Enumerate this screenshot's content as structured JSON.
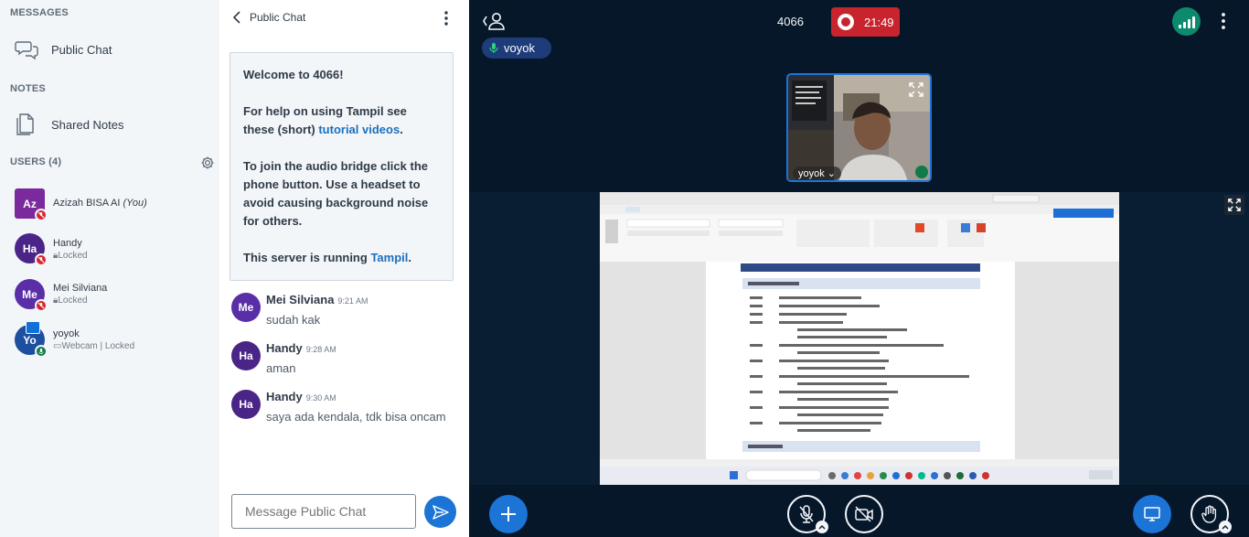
{
  "sidebar": {
    "messages_title": "MESSAGES",
    "public_chat_label": "Public Chat",
    "notes_title": "NOTES",
    "shared_notes_label": "Shared Notes",
    "users_title": "USERS (4)",
    "users": [
      {
        "initials": "Az",
        "name": "Azizah BISA AI",
        "you_tag": "(You)",
        "status": "",
        "color": "#7b2a9e",
        "square": true
      },
      {
        "initials": "Ha",
        "name": "Handy",
        "status": "Locked",
        "color": "#4b2488"
      },
      {
        "initials": "Me",
        "name": "Mei Silviana",
        "status": "Locked",
        "color": "#5a2ea6"
      },
      {
        "initials": "Yo",
        "name": "yoyok",
        "status": "Webcam | Locked",
        "color": "#1d4fa0"
      }
    ]
  },
  "chat": {
    "title": "Public Chat",
    "welcome": {
      "line1": "Welcome to 4066!",
      "help_prefix": "For help on using Tampil see these (short) ",
      "help_link": "tutorial videos",
      "help_suffix": ".",
      "audio": "To join the audio bridge click the phone button. Use a headset to avoid causing background noise for others.",
      "server_prefix": "This server is running ",
      "server_link": "Tampil",
      "server_suffix": "."
    },
    "messages": [
      {
        "initials": "Me",
        "name": "Mei Silviana",
        "time": "9:21 AM",
        "text": "sudah kak"
      },
      {
        "initials": "Ha",
        "name": "Handy",
        "time": "9:28 AM",
        "text": "aman"
      },
      {
        "initials": "Ha",
        "name": "Handy",
        "time": "9:30 AM",
        "text": "saya ada kendala, tdk bisa oncam"
      }
    ],
    "input_placeholder": "Message Public Chat"
  },
  "stage": {
    "meeting_id": "4066",
    "recording_time": "21:49",
    "talker_name": "voyok",
    "webcam_name": "yoyok",
    "colors": {
      "accent": "#1b74d6",
      "record": "#c7242d",
      "stage_bg": "#06172a",
      "connection": "#0d8a6d"
    }
  }
}
